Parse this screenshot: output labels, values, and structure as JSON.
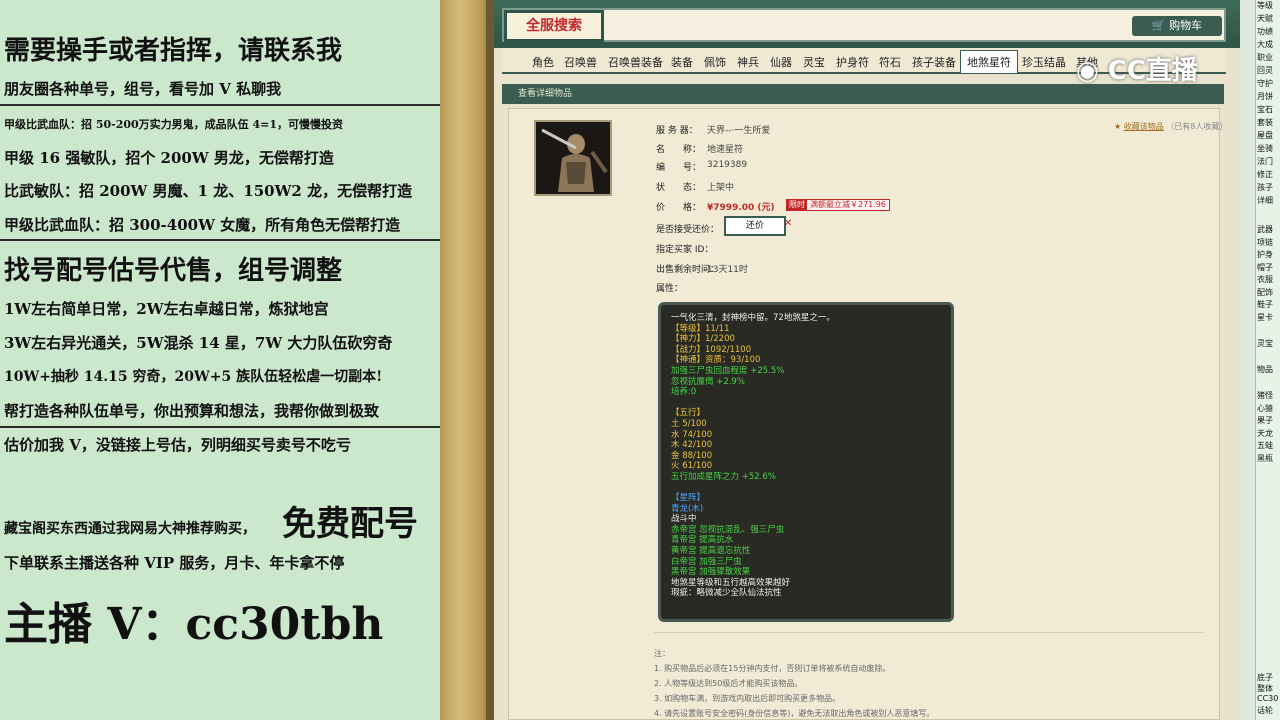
{
  "left_panel": {
    "lines": [
      "需要操手或者指挥，请联系我",
      "朋友圈各种单号，组号，看号加 V 私聊我",
      "甲级比武血队：招 50-200万实力男鬼，成品队伍 4=1，可慢慢投资",
      "甲级 16 强敏队，招个 200W 男龙，无偿帮打造",
      "比武敏队：招 200W 男魔、1 龙、150W2 龙，无偿帮打造",
      "甲级比武血队：招 300-400W 女魔，所有角色无偿帮打造",
      "找号配号估号代售，组号调整",
      "1W左右简单日常，2W左右卓越日常，炼狱地宫",
      "3W左右异光通关，5W混杀 14 星，7W 大力队伍砍穷奇",
      "10W+抽秒 14.15 穷奇，20W+5 族队伍轻松虐一切副本!",
      "帮打造各种队伍单号，你出预算和想法，我帮你做到极致",
      "估价加我 V，没链接上号估，列明细买号卖号不吃亏",
      "藏宝阁买东西通过我网易大神推荐购买，",
      "免费配号",
      "下单联系主播送各种 VIP 服务，月卡、年卡拿不停",
      "主播 V：cc30tbh"
    ]
  },
  "game": {
    "search_button": "全服搜索",
    "cart_button": "购物车",
    "tabs": [
      "角色",
      "召唤兽",
      "召唤兽装备",
      "装备",
      "佩饰",
      "神兵",
      "仙器",
      "灵宝",
      "护身符",
      "符石",
      "孩子装备",
      "地煞星符",
      "珍玉结晶",
      "其他"
    ],
    "subheader": "查看详细物品",
    "favorite": "收藏该物品",
    "favorite_count": "（已有8人收藏）",
    "fields": {
      "server_label": "服 务 器：",
      "server_value": "天界--·一生所爱",
      "name_label": "名　　称：",
      "name_value": "地速星符",
      "id_label": "编　　号：",
      "id_value": "3219389",
      "status_label": "状　　态：",
      "status_value": "上架中",
      "price_label": "价　　格：",
      "price_value": "¥7999.00 (元)",
      "limit_tag": "限时",
      "promo_value": "满额最立减￥271.96",
      "bargain_label": "是否接受还价：",
      "bargain_button": "还价",
      "buyer_label": "指定买家 ID：",
      "time_label": "出售剩余时间：",
      "time_value": "13天11时",
      "attr_label": "属性："
    },
    "attributes": [
      {
        "t": "一气化三清，封神榜中留。72地煞星之一。",
        "c": "w"
      },
      {
        "t": "【等级】11/11",
        "c": "y"
      },
      {
        "t": "【神力】1/2200",
        "c": "y"
      },
      {
        "t": "【战力】1092/1100",
        "c": "y"
      },
      {
        "t": "【神通】资质：93/100",
        "c": "y"
      },
      {
        "t": "加强三尸虫回血程度 +25.5%",
        "c": "g"
      },
      {
        "t": "忽视抗魔偈 +2.9%",
        "c": "g"
      },
      {
        "t": "培养:0",
        "c": "g"
      },
      {
        "t": "",
        "c": "w"
      },
      {
        "t": "【五行】",
        "c": "y"
      },
      {
        "t": "土 5/100",
        "c": "y"
      },
      {
        "t": "水 74/100",
        "c": "y"
      },
      {
        "t": "木 42/100",
        "c": "y"
      },
      {
        "t": "金 88/100",
        "c": "y"
      },
      {
        "t": "火 61/100",
        "c": "y"
      },
      {
        "t": "五行加成星阵之力 +52.6%",
        "c": "g"
      },
      {
        "t": "",
        "c": "w"
      },
      {
        "t": "【星阵】",
        "c": "c"
      },
      {
        "t": "青龙(木)",
        "c": "c"
      },
      {
        "t": "战斗中",
        "c": "w"
      },
      {
        "t": "赤帝宫 忽视抗混乱、强三尸虫",
        "c": "g"
      },
      {
        "t": "青帝宫 提高抗水",
        "c": "g"
      },
      {
        "t": "黄帝宫 提高遗忘抗性",
        "c": "g"
      },
      {
        "t": "白帝宫 加强三尸虫",
        "c": "g"
      },
      {
        "t": "黑帝宫 加强骤散效果",
        "c": "g"
      },
      {
        "t": "地煞星等级和五行越高效果越好",
        "c": "w"
      },
      {
        "t": "瑕疵：略微减少全队仙法抗性",
        "c": "w"
      }
    ],
    "notes": [
      "注：",
      "1. 购买物品后必须在15分钟内支付，否则订单将被系统自动废除。",
      "2. 人物等级达到50级后才能购买该物品。",
      "3. 如购物车满，到游戏内取出后即可购买更多物品。",
      "4. 请先设置账号安全密码(身份信息等)，避免无法取出角色或被别人恶意填写。"
    ]
  },
  "watermark": "CC直播",
  "right_strip": [
    "等级",
    "天赋",
    "功绩",
    "大成",
    "职业",
    "回灵",
    "守护",
    "月饼",
    "宝石",
    "套装",
    "屋盘",
    "坐骑",
    "法门",
    "修正",
    "孩子",
    "详细",
    "武器",
    "项链",
    "护身",
    "帽子",
    "衣服",
    "配饰",
    "鞋子",
    "星卡",
    "灵宝",
    "物品",
    "猪怪",
    "心猿",
    "果子",
    "天龙",
    "五蛙",
    "黑瓶",
    "底子",
    "整体",
    "CC30",
    "话轮"
  ],
  "colors": {
    "accent": "#3b5c50",
    "price": "#c0282a",
    "panel": "#cbe7cc"
  }
}
